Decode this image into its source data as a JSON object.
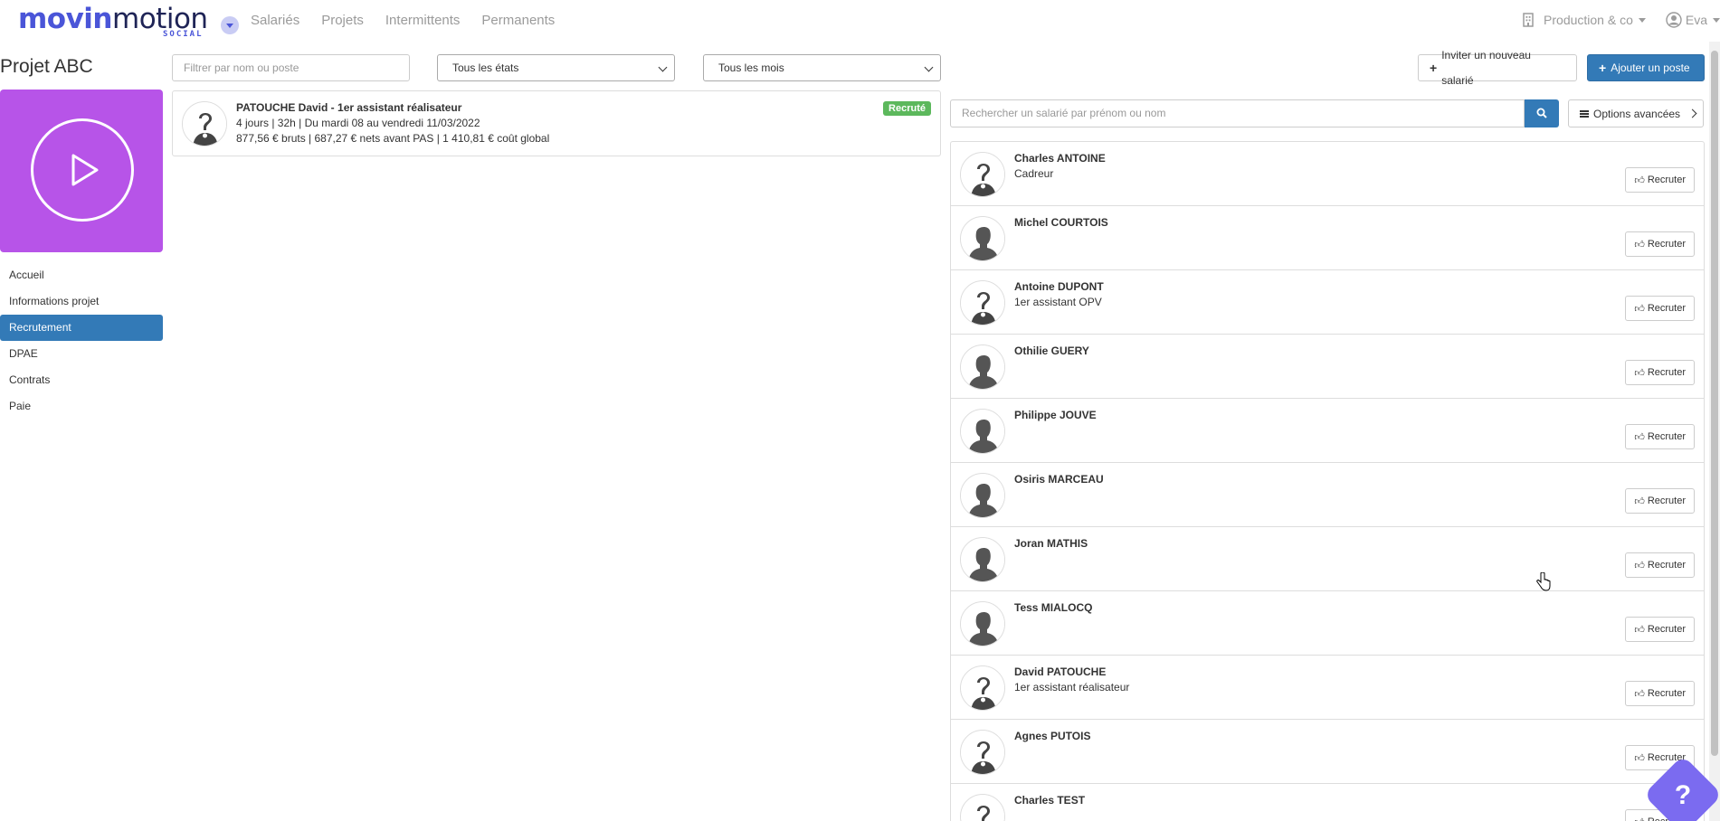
{
  "brand": {
    "name_part1": "movin",
    "name_part2": "motion",
    "sub": "SOCIAL"
  },
  "nav": {
    "links": [
      "Salariés",
      "Projets",
      "Intermittents",
      "Permanents"
    ]
  },
  "top_right": {
    "company": "Production & co",
    "user": "Eva"
  },
  "project": {
    "title": "Projet ABC"
  },
  "sidebar": {
    "items": [
      "Accueil",
      "Informations projet",
      "Recrutement",
      "DPAE",
      "Contrats",
      "Paie"
    ],
    "active_index": 2
  },
  "filters": {
    "name_placeholder": "Filtrer par nom ou poste",
    "state_value": "Tous les états",
    "month_value": "Tous les mois"
  },
  "actions": {
    "invite_label": "Inviter un nouveau salarié",
    "add_label": "Ajouter un poste"
  },
  "recruited": {
    "title": "PATOUCHE David - 1er assistant réalisateur",
    "line1": "4 jours | 32h | Du mardi 08 au vendredi 11/03/2022",
    "line2": "877,56 € bruts | 687,27 € nets avant PAS | 1 410,81 € coût global",
    "badge": "Recruté"
  },
  "search": {
    "placeholder": "Rechercher un salarié par prénom ou nom",
    "options_label": "Options avancées"
  },
  "employees": [
    {
      "name": "Charles ANTOINE",
      "role": "Cadreur",
      "avatar": "question"
    },
    {
      "name": "Michel COURTOIS",
      "role": "",
      "avatar": "person"
    },
    {
      "name": "Antoine DUPONT",
      "role": "1er assistant OPV",
      "avatar": "question"
    },
    {
      "name": "Othilie GUERY",
      "role": "",
      "avatar": "person"
    },
    {
      "name": "Philippe JOUVE",
      "role": "",
      "avatar": "person"
    },
    {
      "name": "Osiris MARCEAU",
      "role": "",
      "avatar": "person"
    },
    {
      "name": "Joran MATHIS",
      "role": "",
      "avatar": "person"
    },
    {
      "name": "Tess MIALOCQ",
      "role": "",
      "avatar": "person"
    },
    {
      "name": "David PATOUCHE",
      "role": "1er assistant réalisateur",
      "avatar": "question"
    },
    {
      "name": "Agnes PUTOIS",
      "role": "",
      "avatar": "question"
    },
    {
      "name": "Charles TEST",
      "role": "",
      "avatar": "question"
    }
  ],
  "recruit_label": "Recruter",
  "help_label": "?",
  "colors": {
    "primary": "#337ab7",
    "accent": "#b754e8",
    "success": "#5cb85c",
    "brand": "#4a55d8"
  }
}
